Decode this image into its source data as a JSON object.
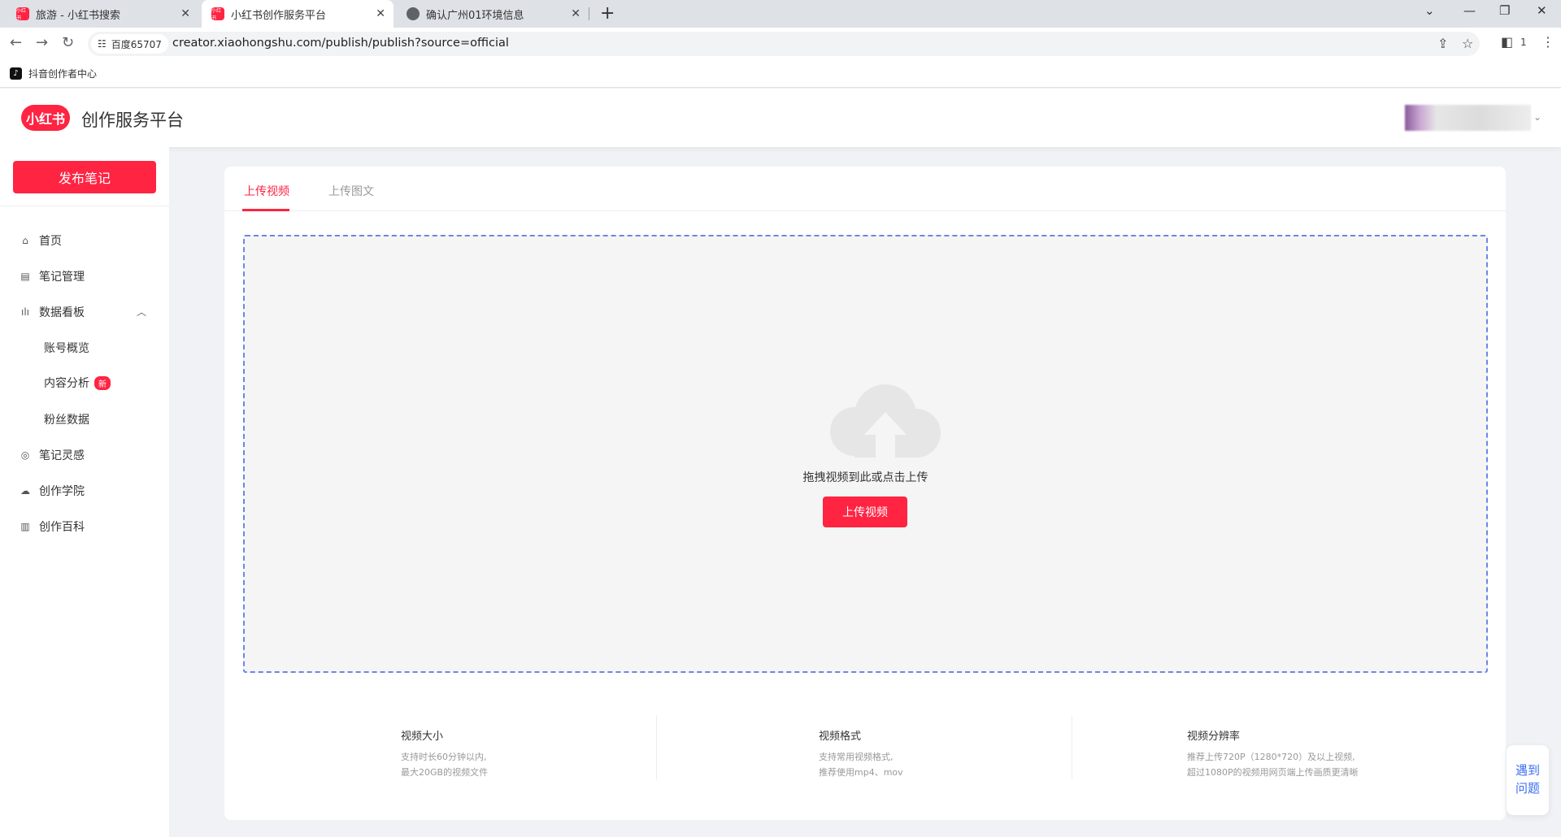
{
  "browser": {
    "tabs": [
      {
        "title": "旅游 - 小红书搜索",
        "favicon": "xiaohongshu-favicon"
      },
      {
        "title": "小红书创作服务平台",
        "favicon": "xiaohongshu-favicon"
      },
      {
        "title": "确认广州01环境信息",
        "favicon": "globe-icon"
      }
    ],
    "favicon_text": "小红书",
    "site_chip": "百度65707",
    "url": "creator.xiaohongshu.com/publish/publish?source=official",
    "profile_count": "1",
    "bookmark": "抖音创作者中心"
  },
  "header": {
    "logo_text": "小红书",
    "title": "创作服务平台"
  },
  "sidebar": {
    "publish_label": "发布笔记",
    "items": [
      {
        "label": "首页",
        "icon": "home-icon"
      },
      {
        "label": "笔记管理",
        "icon": "note-icon"
      },
      {
        "label": "数据看板",
        "icon": "bar-chart-icon"
      },
      {
        "label": "笔记灵感",
        "icon": "inspiration-icon"
      },
      {
        "label": "创作学院",
        "icon": "academy-icon"
      },
      {
        "label": "创作百科",
        "icon": "book-icon"
      }
    ],
    "sub_items": [
      {
        "label": "账号概览"
      },
      {
        "label": "内容分析",
        "badge": "新"
      },
      {
        "label": "粉丝数据"
      }
    ]
  },
  "main": {
    "tabs": [
      "上传视频",
      "上传图文"
    ],
    "drop_text": "拖拽视频到此或点击上传",
    "upload_button": "上传视频",
    "info": [
      {
        "title": "视频大小",
        "lines": [
          "支持时长60分钟以内,",
          "最大20GB的视频文件"
        ]
      },
      {
        "title": "视频格式",
        "lines": [
          "支持常用视频格式,",
          "推荐使用mp4、mov"
        ]
      },
      {
        "title": "视频分辨率",
        "lines": [
          "推荐上传720P（1280*720）及以上视频,",
          "超过1080P的视频用网页端上传画质更清晰"
        ]
      }
    ]
  },
  "help": {
    "line1": "遇到",
    "line2": "问题"
  },
  "colors": {
    "brand": "#ff2442",
    "dashed_border": "#6b87e8",
    "link": "#3a6df0"
  }
}
